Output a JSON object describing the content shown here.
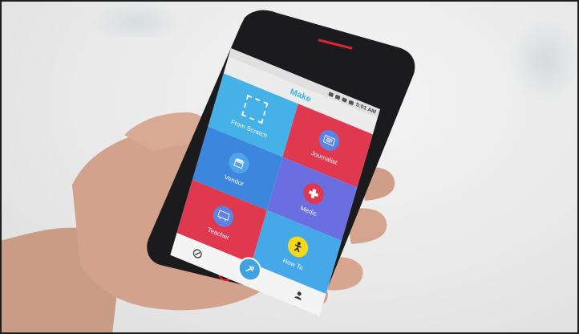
{
  "app": {
    "title": "Make",
    "status_time": "5:01 AM"
  },
  "tiles": [
    {
      "label": "From Scratch",
      "color": "#45b1e6",
      "icon": "dashed-square-icon"
    },
    {
      "label": "Journalist",
      "color": "#e0394f",
      "icon": "newspaper-icon"
    },
    {
      "label": "Vendor",
      "color": "#3c86de",
      "icon": "storefront-icon"
    },
    {
      "label": "Medic",
      "color": "#6a6ee0",
      "icon": "medical-cross-icon"
    },
    {
      "label": "Teacher",
      "color": "#e0394f",
      "icon": "chalkboard-icon"
    },
    {
      "label": "How To",
      "color": "#45a8e8",
      "icon": "figure-icon"
    }
  ],
  "nav": {
    "items": [
      "compass-icon",
      "make-tools-icon",
      "profile-icon"
    ]
  },
  "colors": {
    "accent": "#3fb3e8",
    "red": "#e0394f",
    "blue": "#3c86de",
    "purple": "#6a6ee0",
    "yellow": "#f4d91a"
  }
}
